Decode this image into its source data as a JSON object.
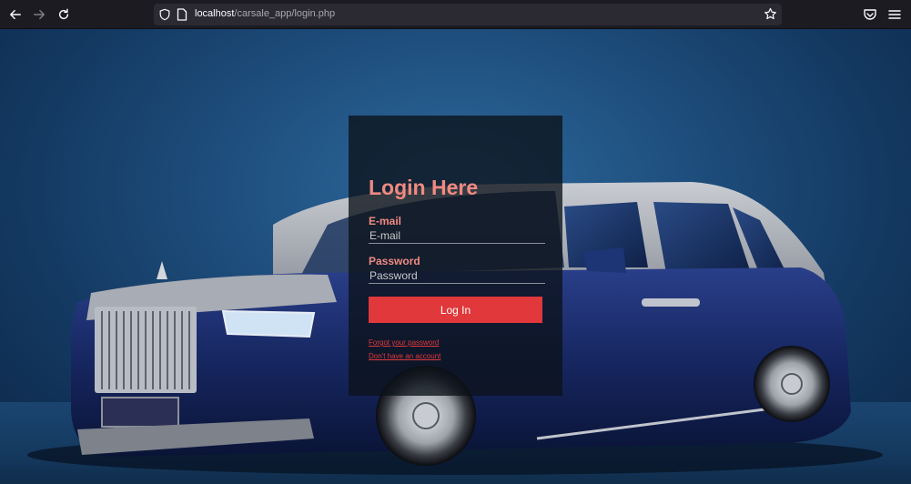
{
  "browser": {
    "url_host": "localhost",
    "url_path": "/carsale_app/login.php",
    "icons": {
      "back": "arrow-left-icon",
      "forward": "arrow-right-icon",
      "reload": "reload-icon",
      "tracking": "shield-icon",
      "page": "page-icon",
      "bookmark": "star-icon",
      "pocket": "pocket-icon",
      "menu": "hamburger-menu-icon"
    }
  },
  "login": {
    "title": "Login Here",
    "email_label": "E-mail",
    "email_placeholder": "E-mail",
    "email_value": "",
    "password_label": "Password",
    "password_placeholder": "Password",
    "password_value": "",
    "submit_label": "Log In",
    "forgot_link": "Forgot your password",
    "signup_link": "Don't have an account"
  },
  "colors": {
    "accent": "#e0383b",
    "label": "#f08a82",
    "panel": "#0c121a",
    "browser_chrome": "#1c1b22"
  }
}
